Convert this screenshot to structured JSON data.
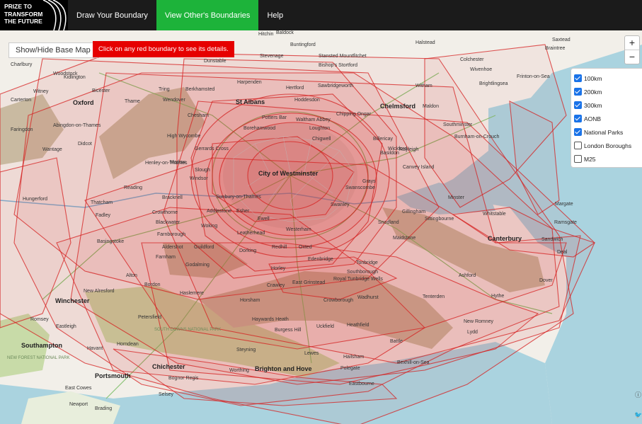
{
  "logo": {
    "text": "PRIZE TO\nTRANSFORM\nTHE FUTURE"
  },
  "nav": [
    {
      "label": "Draw Your Boundary",
      "active": false
    },
    {
      "label": "View Other's Boundaries",
      "active": true
    },
    {
      "label": "Help",
      "active": false
    }
  ],
  "controls": {
    "basemap_toggle": "Show/Hide Base Map",
    "hint": "Click on any red boundary to see its details.",
    "zoom_in": "+",
    "zoom_out": "−"
  },
  "layers": [
    {
      "label": "100km",
      "checked": true
    },
    {
      "label": "200km",
      "checked": true
    },
    {
      "label": "300km",
      "checked": true
    },
    {
      "label": "AONB",
      "checked": true
    },
    {
      "label": "National Parks",
      "checked": true
    },
    {
      "label": "London Boroughs",
      "checked": false
    },
    {
      "label": "M25",
      "checked": false
    }
  ],
  "colors": {
    "boundary": "#d62020",
    "active_nav": "#1db33a",
    "sea": "#aad3df",
    "aonb": "#c9c2a8",
    "park": "#c8dba8"
  },
  "icons": {
    "info": "info-icon",
    "twitter": "twitter-icon"
  },
  "places": [
    {
      "n": "Charlbury",
      "c": "place"
    },
    {
      "n": "Woodstock",
      "c": "place"
    },
    {
      "n": "Kidlington",
      "c": "place"
    },
    {
      "n": "Bicester",
      "c": "place"
    },
    {
      "n": "Witney",
      "c": "place"
    },
    {
      "n": "Carterton",
      "c": "place"
    },
    {
      "n": "Oxford",
      "c": "place big"
    },
    {
      "n": "Thame",
      "c": "place"
    },
    {
      "n": "Faringdon",
      "c": "place"
    },
    {
      "n": "Abingdon-on-Thames",
      "c": "place"
    },
    {
      "n": "Didcot",
      "c": "place"
    },
    {
      "n": "Wantage",
      "c": "place"
    },
    {
      "n": "Hitchin",
      "c": "place"
    },
    {
      "n": "Baldock",
      "c": "place"
    },
    {
      "n": "Buntingford",
      "c": "place"
    },
    {
      "n": "Stevenage",
      "c": "place"
    },
    {
      "n": "Stansted Mountfitchet",
      "c": "place"
    },
    {
      "n": "Bishop's Stortford",
      "c": "place"
    },
    {
      "n": "Dunstable",
      "c": "place"
    },
    {
      "n": "Harpenden",
      "c": "place"
    },
    {
      "n": "Tring",
      "c": "place"
    },
    {
      "n": "Wendover",
      "c": "place"
    },
    {
      "n": "Berkhamsted",
      "c": "place"
    },
    {
      "n": "St Albans",
      "c": "place big"
    },
    {
      "n": "Hertford",
      "c": "place"
    },
    {
      "n": "Sawbridgeworth",
      "c": "place"
    },
    {
      "n": "Hoddesdon",
      "c": "place"
    },
    {
      "n": "Chesham",
      "c": "place"
    },
    {
      "n": "Potters Bar",
      "c": "place"
    },
    {
      "n": "Chipping Ongar",
      "c": "place"
    },
    {
      "n": "Chelmsford",
      "c": "place big"
    },
    {
      "n": "Maldon",
      "c": "place"
    },
    {
      "n": "Borehamwood",
      "c": "place"
    },
    {
      "n": "Waltham Abbey",
      "c": "place"
    },
    {
      "n": "Loughton",
      "c": "place"
    },
    {
      "n": "Billericay",
      "c": "place"
    },
    {
      "n": "High Wycombe",
      "c": "place"
    },
    {
      "n": "Chigwell",
      "c": "place"
    },
    {
      "n": "Gerrards Cross",
      "c": "place"
    },
    {
      "n": "Wickford",
      "c": "place"
    },
    {
      "n": "Basildon",
      "c": "place"
    },
    {
      "n": "Rayleigh",
      "c": "place"
    },
    {
      "n": "Henley-on-Thames",
      "c": "place"
    },
    {
      "n": "Marlow",
      "c": "place"
    },
    {
      "n": "City of Westminster",
      "c": "place big"
    },
    {
      "n": "Slough",
      "c": "place"
    },
    {
      "n": "Windsor",
      "c": "place"
    },
    {
      "n": "Canvey Island",
      "c": "place"
    },
    {
      "n": "Reading",
      "c": "place"
    },
    {
      "n": "Grays",
      "c": "place"
    },
    {
      "n": "Sunbury-on-Thames",
      "c": "place"
    },
    {
      "n": "Swanscombe",
      "c": "place"
    },
    {
      "n": "Bracknell",
      "c": "place"
    },
    {
      "n": "Thatcham",
      "c": "place"
    },
    {
      "n": "Hungerford",
      "c": "place"
    },
    {
      "n": "Crowthorne",
      "c": "place"
    },
    {
      "n": "Addlestone",
      "c": "place"
    },
    {
      "n": "Esher",
      "c": "place"
    },
    {
      "n": "Swanley",
      "c": "place"
    },
    {
      "n": "Gillingham",
      "c": "place"
    },
    {
      "n": "Fadley",
      "c": "place"
    },
    {
      "n": "Blackwater",
      "c": "place"
    },
    {
      "n": "Woking",
      "c": "place"
    },
    {
      "n": "Ewell",
      "c": "place"
    },
    {
      "n": "Snodland",
      "c": "place"
    },
    {
      "n": "Sittingbourne",
      "c": "place"
    },
    {
      "n": "Basingstoke",
      "c": "place"
    },
    {
      "n": "Farnborough",
      "c": "place"
    },
    {
      "n": "Leatherhead",
      "c": "place"
    },
    {
      "n": "Westerham",
      "c": "place"
    },
    {
      "n": "Aldershot",
      "c": "place"
    },
    {
      "n": "Maidstone",
      "c": "place"
    },
    {
      "n": "Farnham",
      "c": "place"
    },
    {
      "n": "Guildford",
      "c": "place"
    },
    {
      "n": "Dorking",
      "c": "place"
    },
    {
      "n": "Redhill",
      "c": "place"
    },
    {
      "n": "Oxted",
      "c": "place"
    },
    {
      "n": "Edenbridge",
      "c": "place"
    },
    {
      "n": "Tonbridge",
      "c": "place"
    },
    {
      "n": "Godalming",
      "c": "place"
    },
    {
      "n": "Horley",
      "c": "place"
    },
    {
      "n": "Southborough",
      "c": "place"
    },
    {
      "n": "Royal Tunbridge Wells",
      "c": "place"
    },
    {
      "n": "Alton",
      "c": "place"
    },
    {
      "n": "Bordon",
      "c": "place"
    },
    {
      "n": "Crawley",
      "c": "place"
    },
    {
      "n": "East Grinstead",
      "c": "place"
    },
    {
      "n": "Haslemere",
      "c": "place"
    },
    {
      "n": "New Alresford",
      "c": "place"
    },
    {
      "n": "Winchester",
      "c": "place big"
    },
    {
      "n": "Horsham",
      "c": "place"
    },
    {
      "n": "Crowborough",
      "c": "place"
    },
    {
      "n": "Wadhurst",
      "c": "place"
    },
    {
      "n": "Tenterden",
      "c": "place"
    },
    {
      "n": "Ashford",
      "c": "place"
    },
    {
      "n": "Romsey",
      "c": "place"
    },
    {
      "n": "Petersfield",
      "c": "place"
    },
    {
      "n": "Haywards Heath",
      "c": "place"
    },
    {
      "n": "Eastleigh",
      "c": "place"
    },
    {
      "n": "SOUTH DOWNS NATIONAL PARK",
      "c": "place park"
    },
    {
      "n": "Burgess Hill",
      "c": "place"
    },
    {
      "n": "Uckfield",
      "c": "place"
    },
    {
      "n": "Heathfield",
      "c": "place"
    },
    {
      "n": "New Romney",
      "c": "place"
    },
    {
      "n": "Lydd",
      "c": "place"
    },
    {
      "n": "Horndean",
      "c": "place"
    },
    {
      "n": "Southampton",
      "c": "place big"
    },
    {
      "n": "Havant",
      "c": "place"
    },
    {
      "n": "Steyning",
      "c": "place"
    },
    {
      "n": "Lewes",
      "c": "place"
    },
    {
      "n": "Battle",
      "c": "place"
    },
    {
      "n": "NEW FOREST NATIONAL PARK",
      "c": "place park"
    },
    {
      "n": "Chichester",
      "c": "place big"
    },
    {
      "n": "Worthing",
      "c": "place"
    },
    {
      "n": "Brighton and Hove",
      "c": "place big"
    },
    {
      "n": "Hailsham",
      "c": "place"
    },
    {
      "n": "Bexhill-on-Sea",
      "c": "place"
    },
    {
      "n": "Portsmouth",
      "c": "place big"
    },
    {
      "n": "Polegate",
      "c": "place"
    },
    {
      "n": "Eastbourne",
      "c": "place"
    },
    {
      "n": "Bognor Regis",
      "c": "place"
    },
    {
      "n": "Selsey",
      "c": "place"
    },
    {
      "n": "East Cowes",
      "c": "place"
    },
    {
      "n": "Newport",
      "c": "place"
    },
    {
      "n": "Brading",
      "c": "place"
    },
    {
      "n": "Halstead",
      "c": "place"
    },
    {
      "n": "Colchester",
      "c": "place"
    },
    {
      "n": "Wivenhoe",
      "c": "place"
    },
    {
      "n": "Frinton-on-Sea",
      "c": "place"
    },
    {
      "n": "Witham",
      "c": "place"
    },
    {
      "n": "Brightlingsea",
      "c": "place"
    },
    {
      "n": "Southminster",
      "c": "place"
    },
    {
      "n": "Burnham-on-Crouch",
      "c": "place"
    },
    {
      "n": "Minster",
      "c": "place"
    },
    {
      "n": "Whitstable",
      "c": "place"
    },
    {
      "n": "Margate",
      "c": "place"
    },
    {
      "n": "Ramsgate",
      "c": "place"
    },
    {
      "n": "Canterbury",
      "c": "place big"
    },
    {
      "n": "Sandwich",
      "c": "place"
    },
    {
      "n": "Deal",
      "c": "place"
    },
    {
      "n": "Dover",
      "c": "place"
    },
    {
      "n": "Hythe",
      "c": "place"
    },
    {
      "n": "Saxtead",
      "c": "place"
    },
    {
      "n": "Braintree",
      "c": "place"
    }
  ]
}
